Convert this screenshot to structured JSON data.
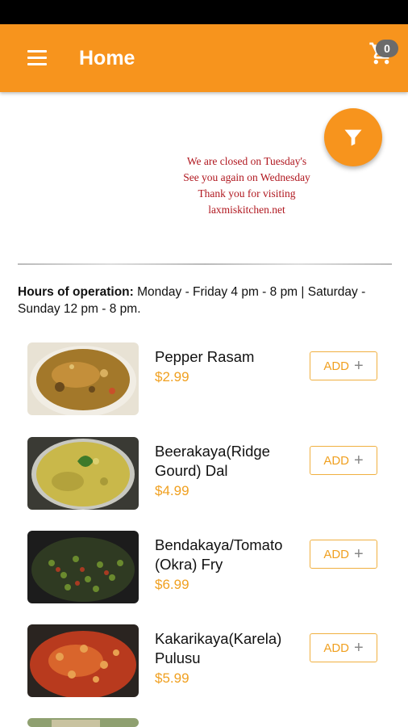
{
  "app_bar": {
    "title": "Home",
    "cart_count": "0"
  },
  "notice": {
    "lines": [
      "We are closed on Tuesday's",
      "See you again on Wednesday",
      "Thank you for visiting",
      "laxmiskitchen.net"
    ]
  },
  "hours": {
    "label": "Hours of operation:",
    "text": " Monday - Friday 4 pm - 8 pm | Saturday - Sunday 12 pm - 8 pm."
  },
  "menu": [
    {
      "name": "Pepper Rasam",
      "price": "$2.99",
      "add_label": "ADD",
      "add_icon": "+"
    },
    {
      "name": "Beerakaya(Ridge Gourd) Dal",
      "price": "$4.99",
      "add_label": "ADD",
      "add_icon": "+"
    },
    {
      "name": "Bendakaya/Tomato (Okra) Fry",
      "price": "$6.99",
      "add_label": "ADD",
      "add_icon": "+"
    },
    {
      "name": "Kakarikaya(Karela) Pulusu",
      "price": "$5.99",
      "add_label": "ADD",
      "add_icon": "+"
    }
  ],
  "icons": {
    "menu": "hamburger-menu-icon",
    "cart": "shopping-cart-icon",
    "filter": "filter-funnel-icon"
  },
  "colors": {
    "primary": "#f7941d",
    "price": "#f0a020",
    "notice": "#b0171f"
  }
}
